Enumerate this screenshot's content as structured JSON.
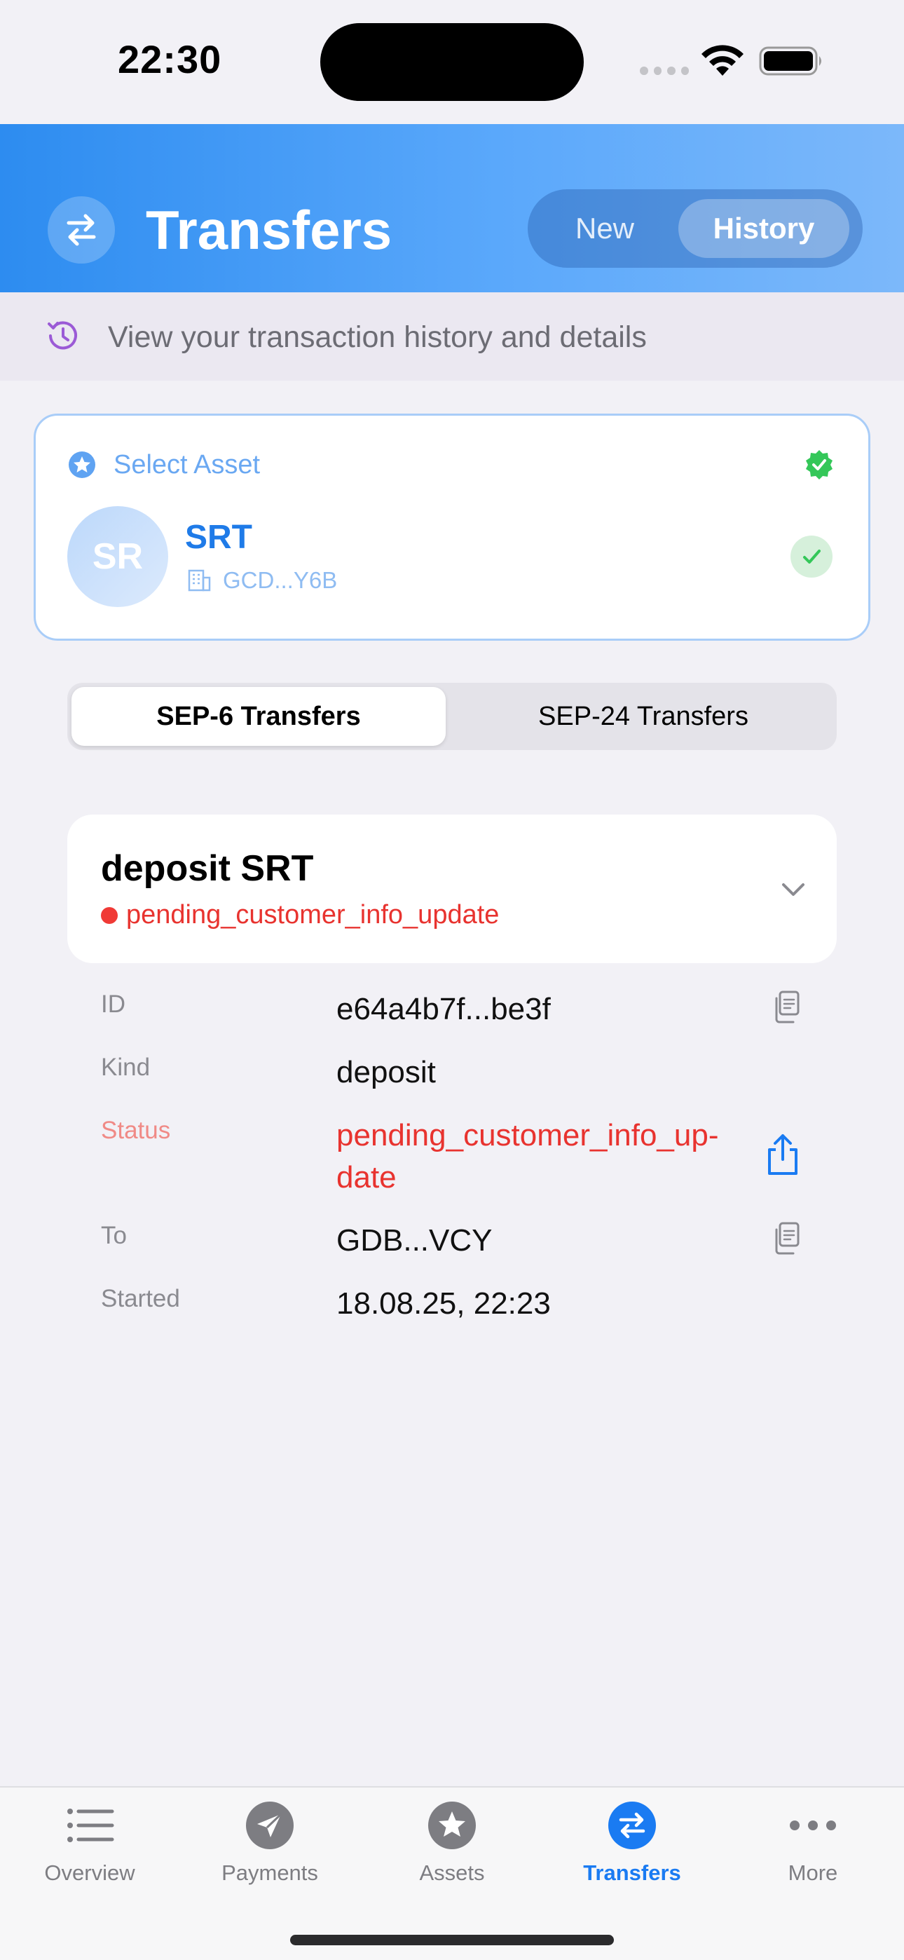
{
  "status_bar": {
    "time": "22:30"
  },
  "header": {
    "title": "Transfers",
    "tabs": [
      {
        "label": "New"
      },
      {
        "label": "History",
        "selected": true
      }
    ]
  },
  "subtitle": "View your transaction history and details",
  "asset_selector": {
    "label": "Select Asset",
    "avatar_initials": "SR",
    "asset_code": "SRT",
    "issuer": "GCD...Y6B"
  },
  "sep_tabs": [
    {
      "label": "SEP-6 Transfers",
      "selected": true
    },
    {
      "label": "SEP-24 Transfers"
    }
  ],
  "transfer": {
    "title": "deposit SRT",
    "status": "pending_customer_info_update",
    "details": {
      "id_label": "ID",
      "id_value": "e64a4b7f...be3f",
      "kind_label": "Kind",
      "kind_value": "deposit",
      "status_label": "Status",
      "status_value": "pending_customer_info_up-\ndate",
      "to_label": "To",
      "to_value": "GDB...VCY",
      "started_label": "Started",
      "started_value": "18.08.25, 22:23"
    }
  },
  "tabbar": {
    "items": [
      {
        "label": "Overview",
        "icon": "list-icon"
      },
      {
        "label": "Payments",
        "icon": "paperplane-icon"
      },
      {
        "label": "Assets",
        "icon": "star-icon"
      },
      {
        "label": "Transfers",
        "icon": "transfer-arrows-icon",
        "active": true
      },
      {
        "label": "More",
        "icon": "ellipsis-icon"
      }
    ]
  },
  "colors": {
    "accent": "#1a7bf2",
    "header_gradient_start": "#2d8cf0",
    "status_red": "#e8332f",
    "success_green": "#34c759"
  }
}
